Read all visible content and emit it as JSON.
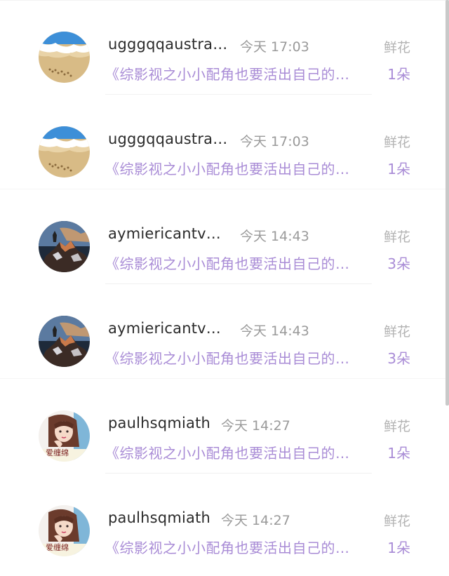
{
  "records": [
    {
      "username": "ugggqqaustra…",
      "time": "今天 17:03",
      "book": "《综影视之小小配角也要活出自己的…",
      "gift_type": "鲜花",
      "gift_count": "1朵",
      "avatar": "beach-avatar"
    },
    {
      "username": "ugggqqaustra…",
      "time": "今天 17:03",
      "book": "《综影视之小小配角也要活出自己的…",
      "gift_type": "鲜花",
      "gift_count": "1朵",
      "avatar": "beach-avatar"
    },
    {
      "username": "aymiericantv…",
      "time": "今天 14:43",
      "book": "《综影视之小小配角也要活出自己的…",
      "gift_type": "鲜花",
      "gift_count": "3朵",
      "avatar": "mountain-avatar"
    },
    {
      "username": "aymiericantv…",
      "time": "今天 14:43",
      "book": "《综影视之小小配角也要活出自己的…",
      "gift_type": "鲜花",
      "gift_count": "3朵",
      "avatar": "mountain-avatar"
    },
    {
      "username": "paulhsqmiath",
      "time": "今天 14:27",
      "book": "《综影视之小小配角也要活出自己的…",
      "gift_type": "鲜花",
      "gift_count": "1朵",
      "avatar": "girl-avatar",
      "avatar_text": "爱缠绵"
    },
    {
      "username": "paulhsqmiath",
      "time": "今天 14:27",
      "book": "《综影视之小小配角也要活出自己的…",
      "gift_type": "鲜花",
      "gift_count": "1朵",
      "avatar": "girl-avatar",
      "avatar_text": "爱缠绵"
    }
  ],
  "colors": {
    "accent_purple": "#a98cd6",
    "username_text": "#2b2b2b",
    "muted_text": "#9a9a9a"
  }
}
